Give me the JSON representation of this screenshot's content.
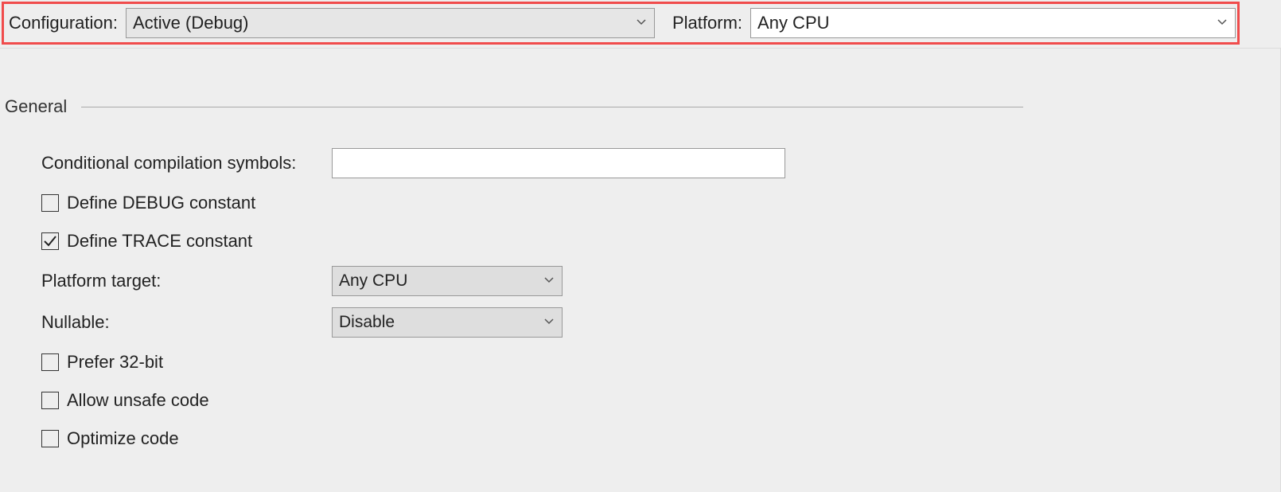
{
  "topbar": {
    "configuration_label": "Configuration:",
    "configuration_value": "Active (Debug)",
    "platform_label": "Platform:",
    "platform_value": "Any CPU"
  },
  "section": {
    "general_title": "General"
  },
  "fields": {
    "cond_symbols_label": "Conditional compilation symbols:",
    "cond_symbols_value": "",
    "define_debug_label": "Define DEBUG constant",
    "define_debug_checked": "false",
    "define_trace_label": "Define TRACE constant",
    "define_trace_checked": "true",
    "platform_target_label": "Platform target:",
    "platform_target_value": "Any CPU",
    "nullable_label": "Nullable:",
    "nullable_value": "Disable",
    "prefer_32bit_label": "Prefer 32-bit",
    "prefer_32bit_checked": "false",
    "allow_unsafe_label": "Allow unsafe code",
    "allow_unsafe_checked": "false",
    "optimize_label": "Optimize code",
    "optimize_checked": "false"
  }
}
